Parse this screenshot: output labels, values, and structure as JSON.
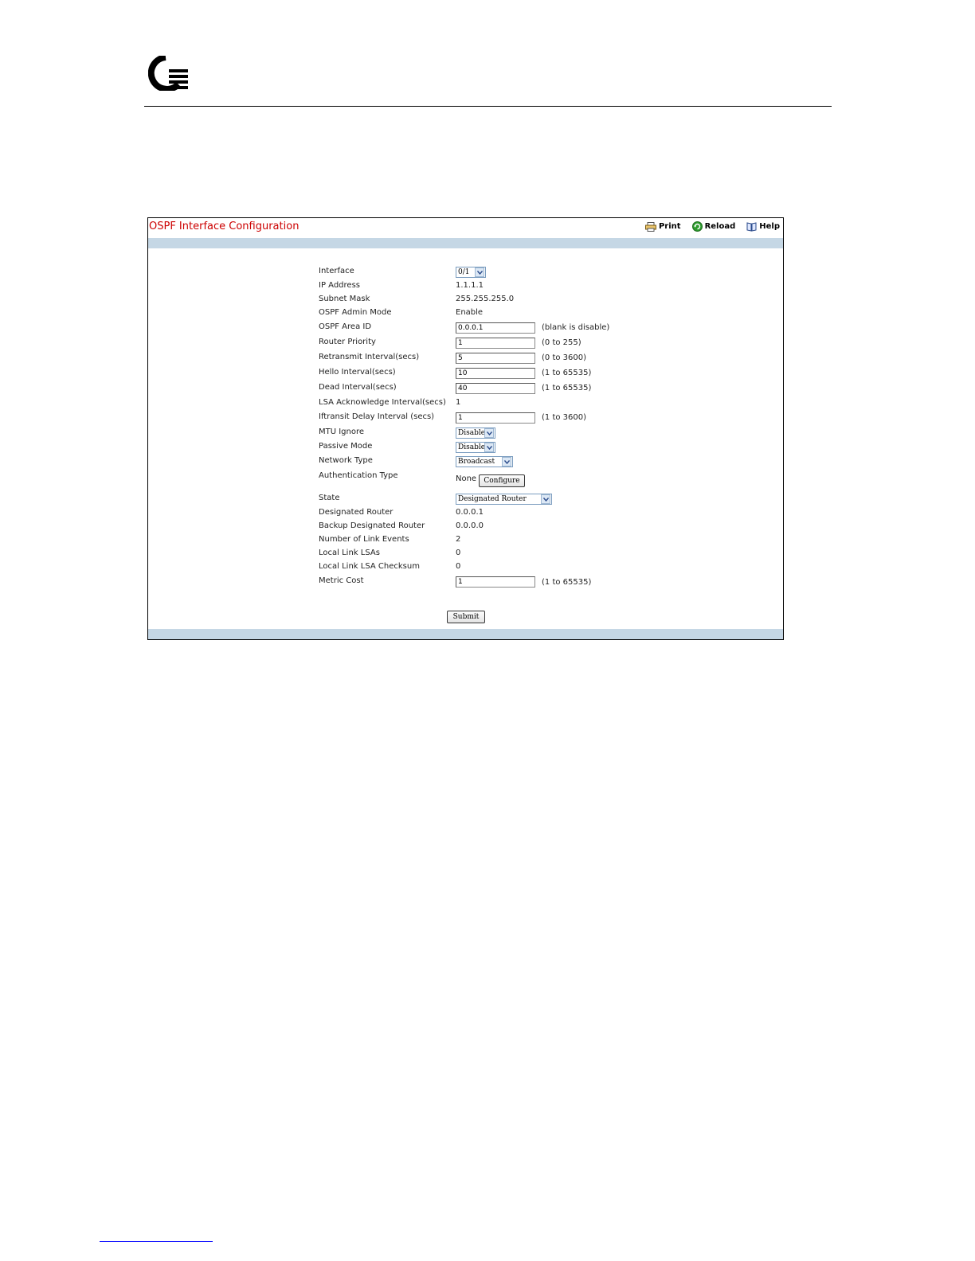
{
  "page": {
    "title": "OSPF Interface Configuration",
    "title_color": "#cc0000",
    "band_color": "#c5d7e5"
  },
  "toolbar": {
    "print": "Print",
    "reload": "Reload",
    "help": "Help"
  },
  "form": {
    "interface": {
      "label": "Interface",
      "value": "0/1"
    },
    "ip_address": {
      "label": "IP Address",
      "value": "1.1.1.1"
    },
    "subnet_mask": {
      "label": "Subnet Mask",
      "value": "255.255.255.0"
    },
    "admin_mode": {
      "label": "OSPF Admin Mode",
      "value": "Enable"
    },
    "area_id": {
      "label": "OSPF Area ID",
      "value": "0.0.0.1",
      "hint": "(blank is disable)"
    },
    "router_priority": {
      "label": "Router Priority",
      "value": "1",
      "hint": "(0 to 255)"
    },
    "retransmit_interval": {
      "label": "Retransmit Interval(secs)",
      "value": "5",
      "hint": "(0 to 3600)"
    },
    "hello_interval": {
      "label": "Hello Interval(secs)",
      "value": "10",
      "hint": "(1 to 65535)"
    },
    "dead_interval": {
      "label": "Dead Interval(secs)",
      "value": "40",
      "hint": "(1 to 65535)"
    },
    "lsa_ack_interval": {
      "label": "LSA Acknowledge Interval(secs)",
      "value": "1"
    },
    "transit_delay": {
      "label": "Iftransit Delay Interval (secs)",
      "value": "1",
      "hint": "(1 to 3600)"
    },
    "mtu_ignore": {
      "label": "MTU Ignore",
      "value": "Disable"
    },
    "passive_mode": {
      "label": "Passive Mode",
      "value": "Disable"
    },
    "network_type": {
      "label": "Network Type",
      "value": "Broadcast"
    },
    "auth_type": {
      "label": "Authentication Type",
      "value": "None",
      "button": "Configure"
    },
    "state": {
      "label": "State",
      "value": "Designated Router"
    },
    "designated_router": {
      "label": "Designated Router",
      "value": "0.0.0.1"
    },
    "backup_designated_router": {
      "label": "Backup Designated Router",
      "value": "0.0.0.0"
    },
    "link_events": {
      "label": "Number of Link Events",
      "value": "2"
    },
    "local_link_lsas": {
      "label": "Local Link LSAs",
      "value": "0"
    },
    "local_link_lsa_checksum": {
      "label": "Local Link LSA Checksum",
      "value": "0"
    },
    "metric_cost": {
      "label": "Metric Cost",
      "value": "1",
      "hint": "(1 to 65535)"
    }
  },
  "submit": "Submit"
}
